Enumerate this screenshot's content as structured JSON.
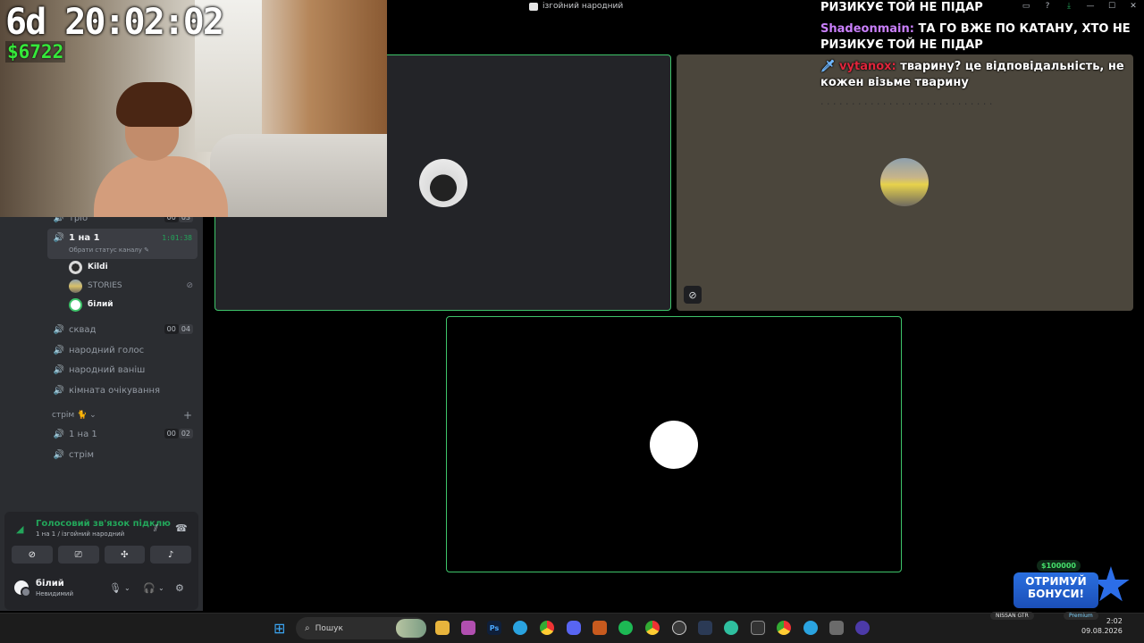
{
  "window": {
    "title": "ізгойний народний",
    "controls": [
      "inbox-icon",
      "help-icon",
      "download-icon",
      "minimize-icon",
      "maximize-icon",
      "close-icon"
    ]
  },
  "stream_overlay": {
    "timer": "6d 20:02:02",
    "money": "$6722"
  },
  "sidebar": {
    "channels": [
      {
        "name": "тріо",
        "count_a": "00",
        "count_b": "03"
      },
      {
        "name": "1 на 1",
        "timer": "1:01:38",
        "status_hint": "Обрати статус каналу"
      },
      {
        "name": "сквад",
        "count_a": "00",
        "count_b": "04"
      },
      {
        "name": "народний голос"
      },
      {
        "name": "народний ваніш"
      },
      {
        "name": "кімната очікування"
      },
      {
        "name": "1 на 1",
        "count_a": "00",
        "count_b": "02"
      },
      {
        "name": "стрім"
      }
    ],
    "voice_users": [
      {
        "name": "Kildi"
      },
      {
        "name": "STORIES",
        "muted": true
      },
      {
        "name": "білий"
      }
    ],
    "category": "стрім 🐈",
    "category_plus": "+"
  },
  "voice_panel": {
    "status": "Голосовий зв'язок підклю",
    "location": "1 на 1 / ізгойний народний"
  },
  "user_panel": {
    "name": "білий",
    "status": "Невидимий"
  },
  "chat": {
    "messages": [
      {
        "user": "",
        "text": "РИЗИКУЄ ТОЙ НЕ ПІДАР"
      },
      {
        "user": "Shadeonmain:",
        "text": "ТА ГО ВЖЕ ПО КАТАНУ, ХТО НЕ РИЗИКУЄ ТОЙ НЕ ПІДАР"
      },
      {
        "user": "vytanox:",
        "text": "тварину? це відповідальність, не кожен візьме тварину"
      }
    ],
    "faded": "· · · · · · · · · · · · · · · · · · · · · · · · · · · ·"
  },
  "promo": {
    "amount": "$100000",
    "line1": "ОТРИМУЙ",
    "line2": "БОНУСИ!"
  },
  "taskbar": {
    "search_placeholder": "Пошук",
    "tray_game": "NISSAN GTR",
    "tray_premium": "Premium",
    "time": "2:02",
    "date": "09.08.2026",
    "apps": [
      "file-explorer",
      "task-app",
      "photoshop",
      "telegram",
      "chrome",
      "discord",
      "torch",
      "spotify",
      "chrome-profile",
      "obs",
      "chat-app",
      "edge",
      "terminal",
      "chrome-2",
      "telegram-2",
      "calculator",
      "media-player"
    ]
  },
  "colors": {
    "accent_green": "#23a55a",
    "tile_border": "#3ec46a",
    "chat_user_purple": "#c97ffb",
    "chat_user_red": "#e0263c",
    "money_green": "#35e83a"
  }
}
